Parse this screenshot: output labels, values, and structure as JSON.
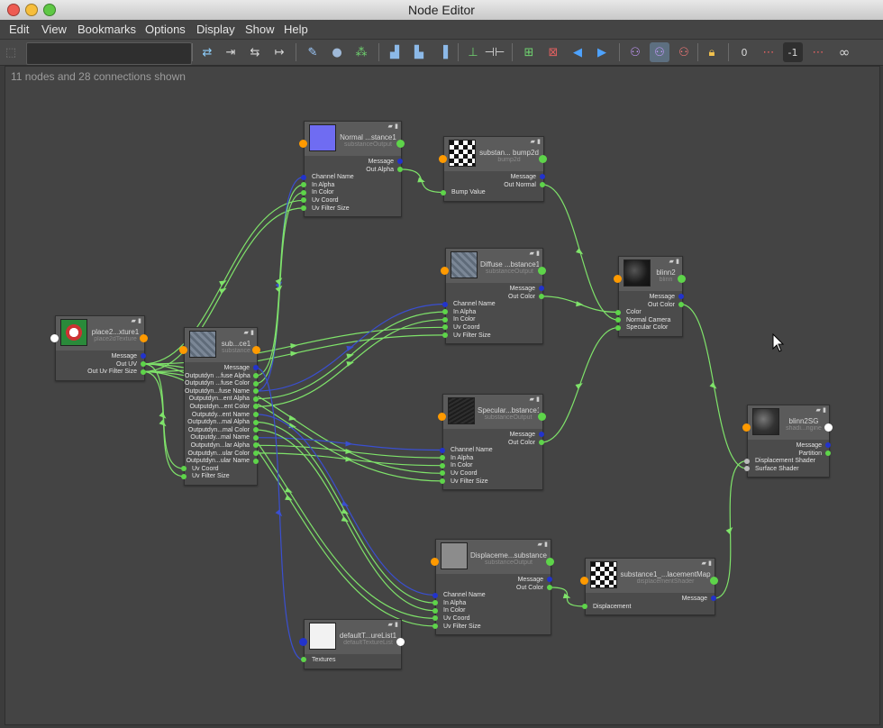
{
  "window": {
    "title": "Node Editor"
  },
  "menu": [
    "Edit",
    "View",
    "Bookmarks",
    "Options",
    "Display",
    "Show",
    "Help"
  ],
  "toolbar": {
    "search_value": "",
    "icons": [
      "swap-arrows-icon",
      "input-connections-icon",
      "io-connections-icon",
      "output-connections-icon",
      "pin-brush-icon",
      "sphere-swatch-icon",
      "network-graph-icon",
      "layout-a-icon",
      "layout-b-icon",
      "layout-c-icon",
      "pin-icon",
      "split-arrows-icon",
      "add-graph-icon",
      "remove-graph-icon",
      "arrow-left-icon",
      "arrow-right-icon",
      "shader-balls-icon",
      "shader-balls-active-icon",
      "shader-balls-remove-icon",
      "lock-icon",
      "attr-zero-icon",
      "attr-red-icon",
      "attr-minus-one-icon",
      "attr-red-b-icon",
      "infinity-icon"
    ],
    "minus_one_label": "-1",
    "zero_label": "0"
  },
  "status": "11 nodes and 28 connections shown",
  "nodes": [
    {
      "id": "place2d",
      "title": "place2...xture1",
      "sub": "place2dTexture",
      "thumb": "place2d",
      "outs": [
        "Message",
        "Out UV",
        "Out Uv Filter Size"
      ],
      "ins": []
    },
    {
      "id": "subst",
      "title": "sub...ce1",
      "sub": "substance",
      "thumb": "stone",
      "outs": [
        "Message",
        "Outputdyn ...fuse Alpha",
        "Outputdyn ...fuse Color",
        "Outputdyn...fuse Name",
        "Outputdyn...ent Alpha",
        "Outputdyn...ent Color",
        "Outputdy...ent Name",
        "Outputdyn...mal Alpha",
        "Outputdyn...mal Color",
        "Outputdy...mal Name",
        "Outputdyn...lar Alpha",
        "Outputdyn...ular Color",
        "Outputdyn...ular Name"
      ],
      "ins": [
        "Uv Coord",
        "Uv Filter Size"
      ]
    },
    {
      "id": "normal",
      "title": "Normal ...stance1",
      "sub": "substanceOutput",
      "thumb": "normal",
      "outs": [
        "Message",
        "Out Alpha"
      ],
      "ins": [
        "Channel Name",
        "In Alpha",
        "In Color",
        "Uv Coord",
        "Uv Filter Size"
      ]
    },
    {
      "id": "bump",
      "title": "substan... bump2d",
      "sub": "bump2d",
      "thumb": "checker",
      "outs": [
        "Message",
        "Out Normal"
      ],
      "ins": [
        "Bump Value"
      ]
    },
    {
      "id": "diffuse",
      "title": "Diffuse ...bstance1",
      "sub": "substanceOutput",
      "thumb": "stone",
      "outs": [
        "Message",
        "Out Color"
      ],
      "ins": [
        "Channel Name",
        "In Alpha",
        "In Color",
        "Uv Coord",
        "Uv Filter Size"
      ]
    },
    {
      "id": "blinn",
      "title": "blinn2",
      "sub": "blinn",
      "thumb": "ball",
      "outs": [
        "Message",
        "Out Color"
      ],
      "ins": [
        "Color",
        "Normal Camera",
        "Specular Color"
      ]
    },
    {
      "id": "specular",
      "title": "Specular...bstance1",
      "sub": "substanceOutput",
      "thumb": "dark",
      "outs": [
        "Message",
        "Out Color"
      ],
      "ins": [
        "Channel Name",
        "In Alpha",
        "In Color",
        "Uv Coord",
        "Uv Filter Size"
      ]
    },
    {
      "id": "sg",
      "title": "blinn2SG",
      "sub": "shadi...ngine",
      "thumb": "sg",
      "outs": [
        "Message",
        "Partition"
      ],
      "ins": [
        "Displacement Shader",
        "Surface Shader"
      ]
    },
    {
      "id": "disp",
      "title": "Displaceme...substance1",
      "sub": "substanceOutput",
      "thumb": "gray",
      "outs": [
        "Message",
        "Out Color"
      ],
      "ins": [
        "Channel Name",
        "In Alpha",
        "In Color",
        "Uv Coord",
        "Uv Filter Size"
      ]
    },
    {
      "id": "dispmap",
      "title": "substance1_...lacementMap",
      "sub": "displacementShader",
      "thumb": "checker",
      "outs": [
        "Message"
      ],
      "ins": [
        "Displacement"
      ]
    },
    {
      "id": "texlist",
      "title": "defaultT...ureList1",
      "sub": "defaultTextureList",
      "thumb": "doc",
      "outs": [],
      "ins": [
        "Textures"
      ]
    }
  ],
  "colors": {
    "wire": "#7fe36a",
    "wire_blue": "#3a4fd0",
    "port_orange": "#ff9a00",
    "port_green": "#5ed44a",
    "port_blue": "#2233cc"
  }
}
